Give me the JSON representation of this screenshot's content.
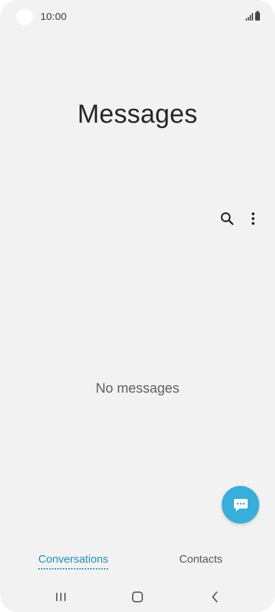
{
  "status_bar": {
    "time": "10:00",
    "icons": [
      "camera-hole",
      "signal-icon",
      "battery-icon"
    ]
  },
  "header": {
    "title": "Messages"
  },
  "toolbar": {
    "icons": [
      "search-icon",
      "more-vertical-icon"
    ]
  },
  "main": {
    "empty_text": "No messages"
  },
  "fab": {
    "icon": "chat-bubble-icon",
    "color": "#3aaedb"
  },
  "tabs": [
    {
      "label": "Conversations",
      "active": true
    },
    {
      "label": "Contacts",
      "active": false
    }
  ],
  "nav_bar": {
    "icons": [
      "recents-icon",
      "home-icon",
      "back-icon"
    ]
  },
  "colors": {
    "accent": "#1a8fbd",
    "background": "#f2f2f2"
  }
}
